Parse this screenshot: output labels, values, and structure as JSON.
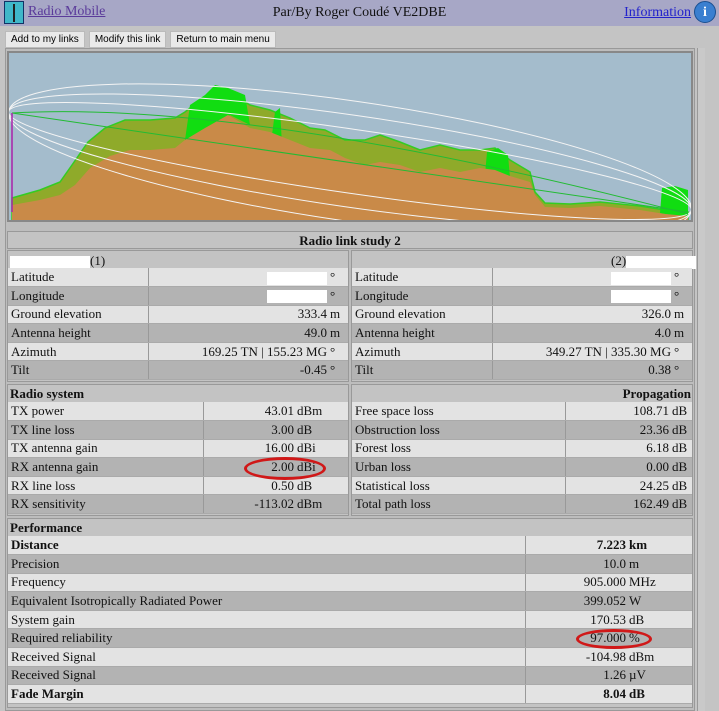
{
  "header": {
    "app_name": "Radio Mobile",
    "author": "Par/By Roger Coudé VE2DBE",
    "information": "Information",
    "info_icon": "i"
  },
  "toolbar": {
    "add": "Add to my links",
    "modify": "Modify this link",
    "return": "Return to main menu"
  },
  "title": "Radio link study 2",
  "site1": {
    "label": "(1)",
    "rows": [
      {
        "label": "Latitude",
        "value": "",
        "unit": "°"
      },
      {
        "label": "Longitude",
        "value": "",
        "unit": "°"
      },
      {
        "label": "Ground elevation",
        "value": "333.4",
        "unit": "m"
      },
      {
        "label": "Antenna height",
        "value": "49.0",
        "unit": "m"
      },
      {
        "label": "Azimuth",
        "value": "169.25 TN | 155.23 MG",
        "unit": "°"
      },
      {
        "label": "Tilt",
        "value": "-0.45",
        "unit": "°"
      }
    ]
  },
  "site2": {
    "label": "(2)",
    "rows": [
      {
        "label": "Latitude",
        "value": "",
        "unit": "°"
      },
      {
        "label": "Longitude",
        "value": "",
        "unit": "°"
      },
      {
        "label": "Ground elevation",
        "value": "326.0",
        "unit": "m"
      },
      {
        "label": "Antenna height",
        "value": "4.0",
        "unit": "m"
      },
      {
        "label": "Azimuth",
        "value": "349.27 TN | 335.30 MG",
        "unit": "°"
      },
      {
        "label": "Tilt",
        "value": "0.38",
        "unit": "°"
      }
    ]
  },
  "radio": {
    "title": "Radio system",
    "rows": [
      {
        "label": "TX power",
        "value": "43.01",
        "unit": "dBm"
      },
      {
        "label": "TX line loss",
        "value": "3.00",
        "unit": "dB"
      },
      {
        "label": "TX antenna gain",
        "value": "16.00",
        "unit": "dBi"
      },
      {
        "label": "RX antenna gain",
        "value": "2.00",
        "unit": "dBi"
      },
      {
        "label": "RX line loss",
        "value": "0.50",
        "unit": "dB"
      },
      {
        "label": "RX sensitivity",
        "value": "-113.02",
        "unit": "dBm"
      }
    ]
  },
  "propagation": {
    "title": "Propagation",
    "rows": [
      {
        "label": "Free space loss",
        "value": "108.71",
        "unit": "dB"
      },
      {
        "label": "Obstruction loss",
        "value": "23.36",
        "unit": "dB"
      },
      {
        "label": "Forest loss",
        "value": "6.18",
        "unit": "dB"
      },
      {
        "label": "Urban loss",
        "value": "0.00",
        "unit": "dB"
      },
      {
        "label": "Statistical loss",
        "value": "24.25",
        "unit": "dB"
      },
      {
        "label": "Total path loss",
        "value": "162.49",
        "unit": "dB"
      }
    ]
  },
  "performance": {
    "title": "Performance",
    "rows": [
      {
        "label": "Distance",
        "value": "7.223",
        "unit": "km",
        "bold": true
      },
      {
        "label": "Precision",
        "value": "10.0",
        "unit": "m"
      },
      {
        "label": "Frequency",
        "value": "905.000",
        "unit": "MHz"
      },
      {
        "label": "Equivalent Isotropically Radiated Power",
        "value": "399.052",
        "unit": "W"
      },
      {
        "label": "System gain",
        "value": "170.53",
        "unit": "dB"
      },
      {
        "label": "Required reliability",
        "value": "97.000",
        "unit": "%"
      },
      {
        "label": "Received Signal",
        "value": "-104.98",
        "unit": "dBm"
      },
      {
        "label": "Received Signal",
        "value": "1.26",
        "unit": "µV"
      },
      {
        "label": "Fade Margin",
        "value": "8.04",
        "unit": "dB",
        "bold": true
      }
    ]
  }
}
